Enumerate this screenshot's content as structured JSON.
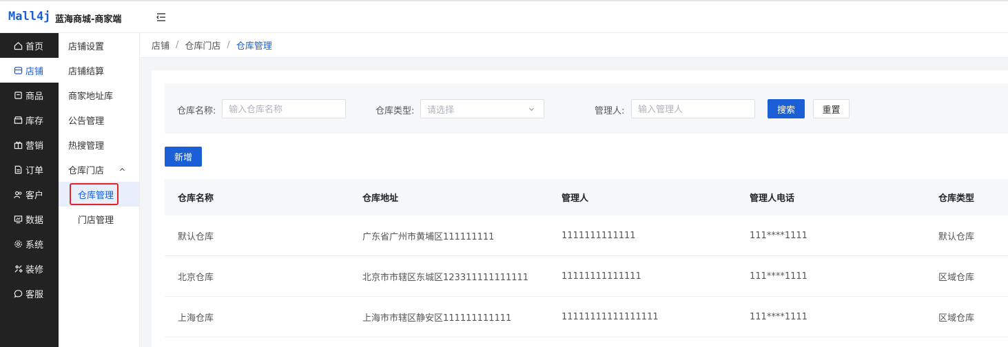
{
  "header": {
    "logo": "Mall4j",
    "title": "蓝海商城-商家端"
  },
  "rail": [
    {
      "label": "首页",
      "icon": "home-icon"
    },
    {
      "label": "店铺",
      "icon": "store-icon",
      "active": true
    },
    {
      "label": "商品",
      "icon": "goods-icon"
    },
    {
      "label": "库存",
      "icon": "inventory-icon"
    },
    {
      "label": "营销",
      "icon": "gift-icon"
    },
    {
      "label": "订单",
      "icon": "order-icon"
    },
    {
      "label": "客户",
      "icon": "customer-icon"
    },
    {
      "label": "数据",
      "icon": "data-icon"
    },
    {
      "label": "系统",
      "icon": "settings-icon"
    },
    {
      "label": "装修",
      "icon": "decoration-icon"
    },
    {
      "label": "客服",
      "icon": "chat-icon"
    }
  ],
  "subnav": {
    "items": [
      "店铺设置",
      "店铺结算",
      "商家地址库",
      "公告管理",
      "热搜管理"
    ],
    "group": "仓库门店",
    "children": [
      "仓库管理",
      "门店管理"
    ]
  },
  "breadcrumb": [
    "店铺",
    "仓库门店",
    "仓库管理"
  ],
  "filters": {
    "name_label": "仓库名称:",
    "name_placeholder": "输入仓库名称",
    "type_label": "仓库类型:",
    "type_placeholder": "请选择",
    "manager_label": "管理人:",
    "manager_placeholder": "输入管理人",
    "search_label": "搜索",
    "reset_label": "重置"
  },
  "add_label": "新增",
  "table": {
    "columns": [
      "仓库名称",
      "仓库地址",
      "管理人",
      "管理人电话",
      "仓库类型"
    ],
    "rows": [
      [
        "默认仓库",
        "广东省广州市黄埔区111111111",
        "1111111111111",
        "111****1111",
        "默认仓库"
      ],
      [
        "北京仓库",
        "北京市市辖区东城区123311111111111",
        "11111111111111",
        "111****1111",
        "区域仓库"
      ],
      [
        "上海仓库",
        "上海市市辖区静安区111111111111",
        "11111111111111111",
        "111****1111",
        "区域仓库"
      ]
    ]
  },
  "colors": {
    "accent": "#1a5fd6",
    "rail_bg": "#222222",
    "highlight": "#e52222"
  }
}
